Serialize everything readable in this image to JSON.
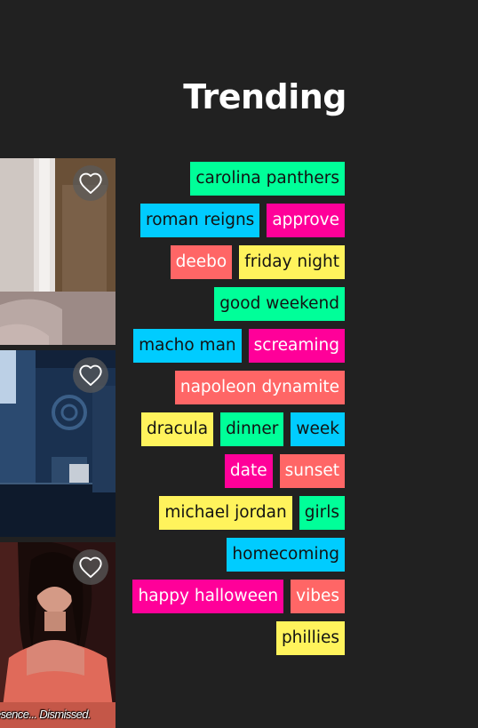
{
  "header": {
    "title": "Trending"
  },
  "gifs": [
    {
      "favorite_icon": "heart-outline-icon",
      "caption": ""
    },
    {
      "favorite_icon": "heart-outline-icon",
      "caption": ""
    },
    {
      "favorite_icon": "heart-outline-icon",
      "caption": "esence... Dismissed."
    }
  ],
  "colors": {
    "background": "#212121",
    "green": "#00ff99",
    "blue": "#00ccff",
    "pink": "#ff0099",
    "orange": "#ff6666",
    "yellow": "#fff35c"
  },
  "tags": [
    {
      "label": "carolina panthers",
      "color": "#00ff99",
      "text_color": "#121212"
    },
    {
      "label": "roman reigns",
      "color": "#00ccff",
      "text_color": "#121212"
    },
    {
      "label": "approve",
      "color": "#ff0099",
      "text_color": "#ffffff"
    },
    {
      "label": "deebo",
      "color": "#ff6666",
      "text_color": "#ffffff"
    },
    {
      "label": "friday night",
      "color": "#fff35c",
      "text_color": "#121212"
    },
    {
      "label": "good weekend",
      "color": "#00ff99",
      "text_color": "#121212"
    },
    {
      "label": "macho man",
      "color": "#00ccff",
      "text_color": "#121212"
    },
    {
      "label": "screaming",
      "color": "#ff0099",
      "text_color": "#ffffff"
    },
    {
      "label": "napoleon dynamite",
      "color": "#ff6666",
      "text_color": "#ffffff"
    },
    {
      "label": "dracula",
      "color": "#fff35c",
      "text_color": "#121212"
    },
    {
      "label": "dinner",
      "color": "#00ff99",
      "text_color": "#121212"
    },
    {
      "label": "week",
      "color": "#00ccff",
      "text_color": "#121212"
    },
    {
      "label": "date",
      "color": "#ff0099",
      "text_color": "#ffffff"
    },
    {
      "label": "sunset",
      "color": "#ff6666",
      "text_color": "#ffffff"
    },
    {
      "label": "michael jordan",
      "color": "#fff35c",
      "text_color": "#121212"
    },
    {
      "label": "girls",
      "color": "#00ff99",
      "text_color": "#121212"
    },
    {
      "label": "homecoming",
      "color": "#00ccff",
      "text_color": "#121212"
    },
    {
      "label": "happy halloween",
      "color": "#ff0099",
      "text_color": "#ffffff"
    },
    {
      "label": "vibes",
      "color": "#ff6666",
      "text_color": "#ffffff"
    },
    {
      "label": "phillies",
      "color": "#fff35c",
      "text_color": "#121212"
    }
  ]
}
